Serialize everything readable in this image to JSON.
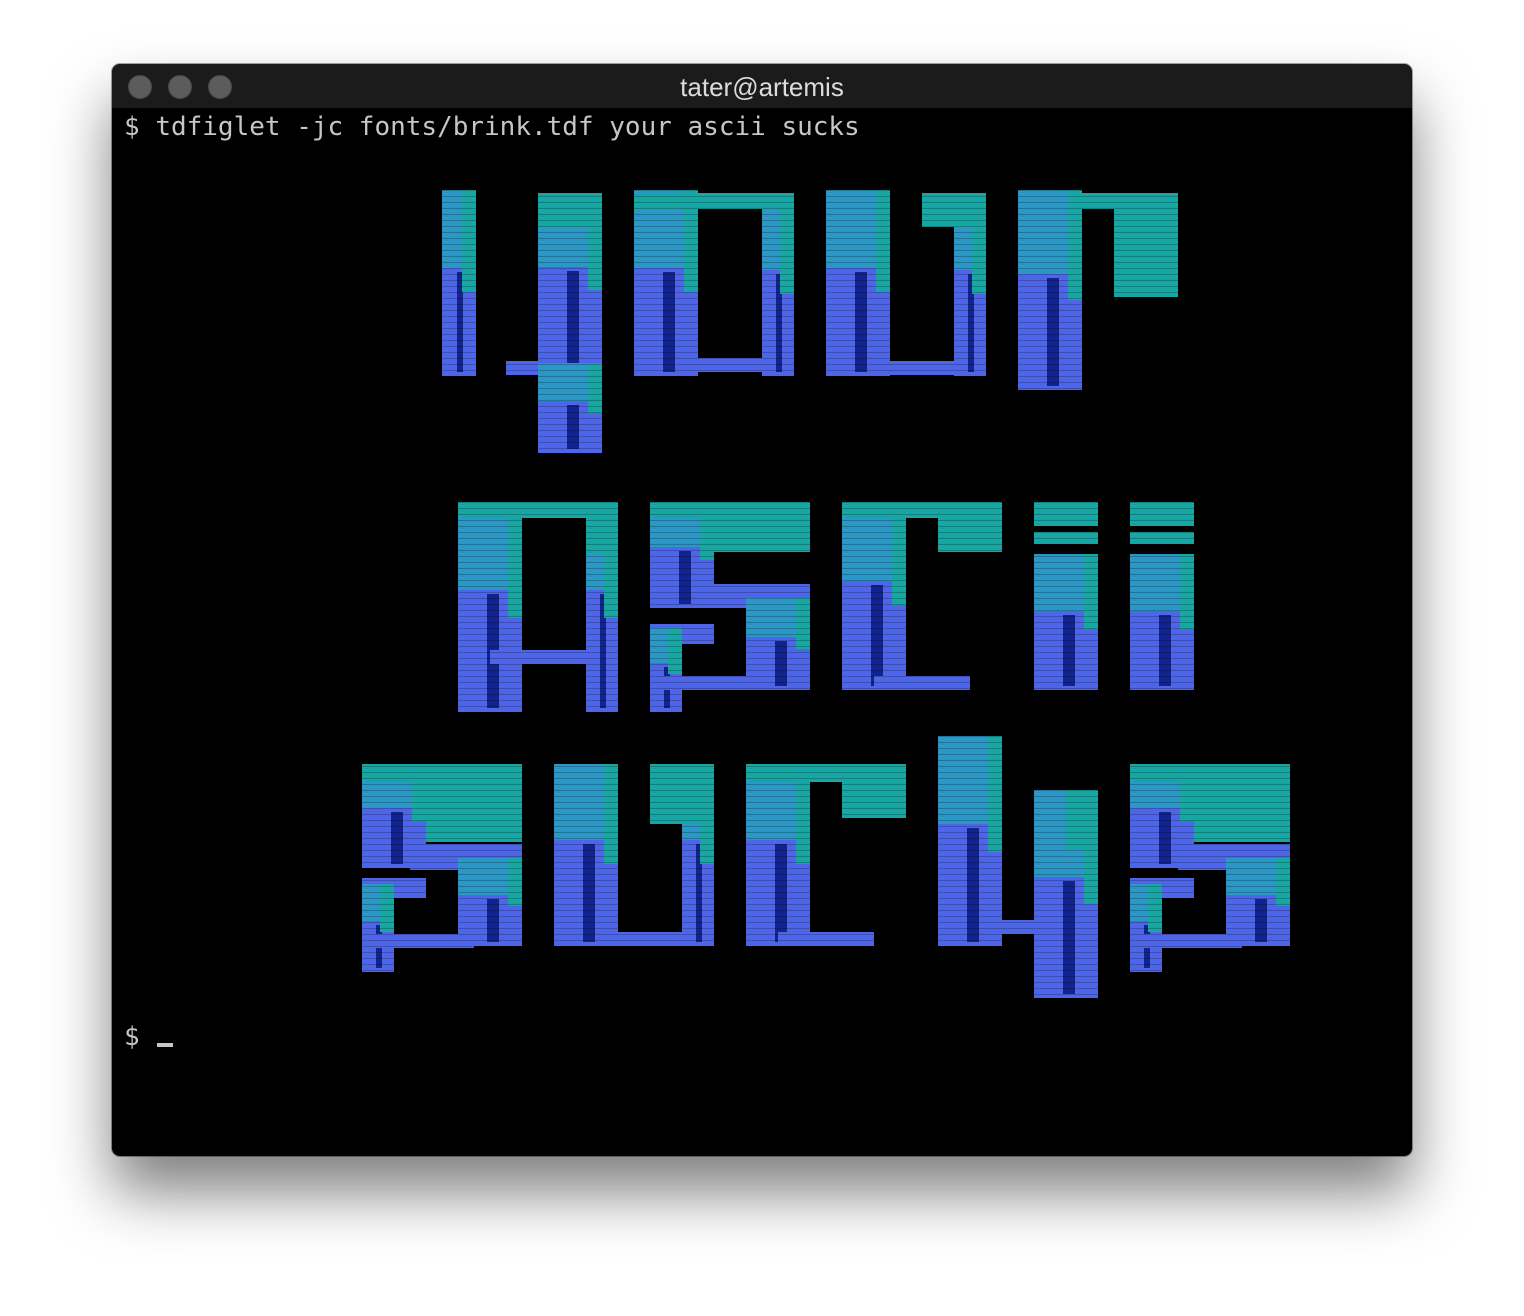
{
  "window": {
    "title": "tater@artemis"
  },
  "terminal": {
    "prompt": "$",
    "command": "tdfiglet -jc fonts/brink.tdf your ascii sucks",
    "prompt2": "$",
    "background": "#000000",
    "foreground": "#c6c6c6"
  },
  "banner": {
    "text_lines": [
      "your",
      "ascii",
      "sucks"
    ],
    "font": "brink.tdf",
    "colors": {
      "teal": "#16a6a4",
      "blue": "#2a97c6",
      "periwinkle": "#4d65e8",
      "navy": "#11238e"
    }
  },
  "icons": [
    "close-icon",
    "minimize-icon",
    "zoom-icon",
    "cursor-icon"
  ]
}
